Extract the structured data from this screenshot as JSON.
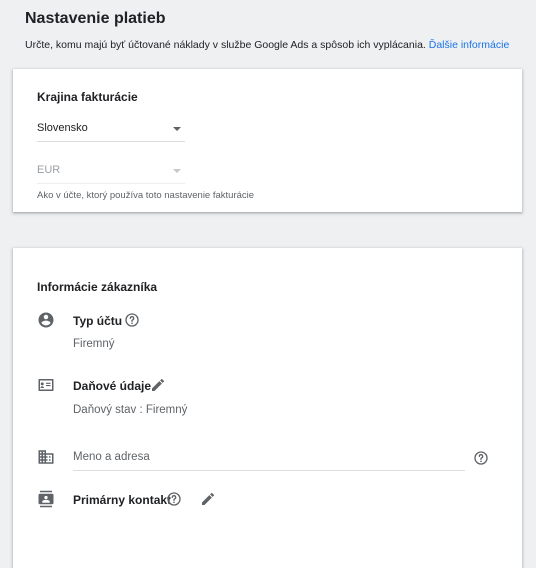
{
  "header": {
    "title": "Nastavenie platieb",
    "subtitle": "Určte, komu majú byť účtované náklady v službe Google Ads a spôsob ich vyplácania.",
    "link": "Ďalšie informácie"
  },
  "billing_country": {
    "title": "Krajina fakturácie",
    "country_value": "Slovensko",
    "currency_value": "EUR",
    "hint": "Ako v účte, ktorý používa toto nastavenie fakturácie"
  },
  "customer_info": {
    "title": "Informácie zákazníka",
    "account_type": {
      "label": "Typ účtu",
      "value": "Firemný",
      "icon": "account-circle-icon"
    },
    "tax": {
      "label": "Daňové údaje",
      "status_label": "Daňový stav",
      "status_value": "Firemný",
      "icon": "tax-id-card-icon"
    },
    "address": {
      "placeholder": "Meno a adresa",
      "icon": "business-building-icon"
    },
    "primary_contact": {
      "label": "Primárny kontakt",
      "icon": "contact-card-icon"
    }
  },
  "colors": {
    "link": "#1a73e8",
    "icon": "#5f6368",
    "background": "#eef0f2"
  }
}
